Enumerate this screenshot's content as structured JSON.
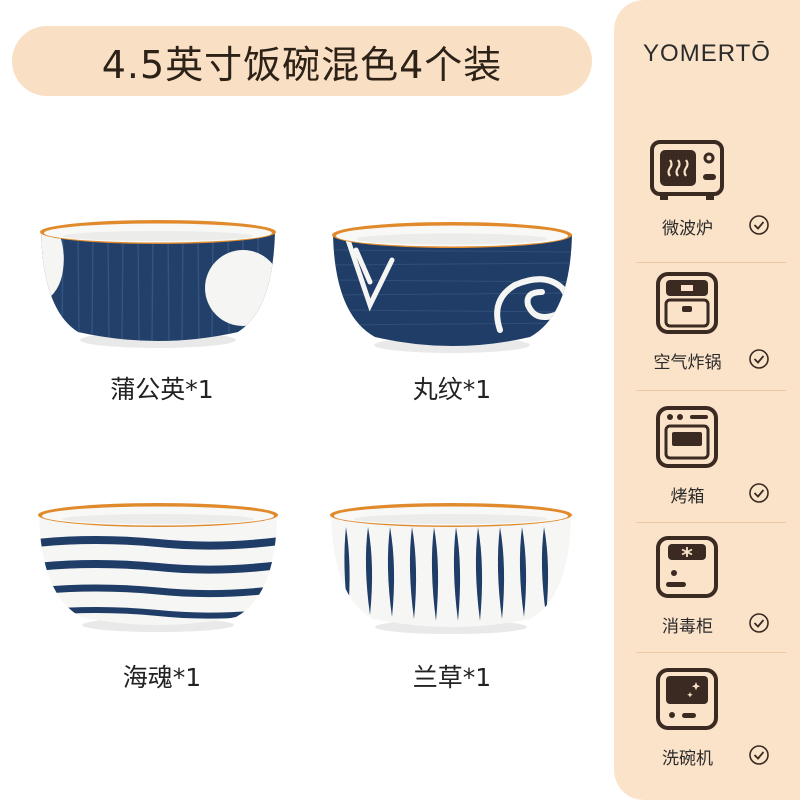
{
  "title": "4.5英寸饭碗混色4个装",
  "brand": "YOMERTŌ",
  "bowls": [
    {
      "label": "蒲公英*1"
    },
    {
      "label": "丸纹*1"
    },
    {
      "label": "海魂*1"
    },
    {
      "label": "兰草*1"
    }
  ],
  "appliances": [
    {
      "label": "微波炉",
      "icon": "microwave-icon"
    },
    {
      "label": "空气炸锅",
      "icon": "air-fryer-icon"
    },
    {
      "label": "烤箱",
      "icon": "oven-icon"
    },
    {
      "label": "消毒柜",
      "icon": "sterilizer-icon"
    },
    {
      "label": "洗碗机",
      "icon": "dishwasher-icon"
    }
  ],
  "colors": {
    "title_bg": "#f9dfc3",
    "sidebar_bg": "#fbe3c9",
    "navy": "#1d3b63",
    "rim": "#e08a2c",
    "icon_dark": "#3a2a22"
  }
}
